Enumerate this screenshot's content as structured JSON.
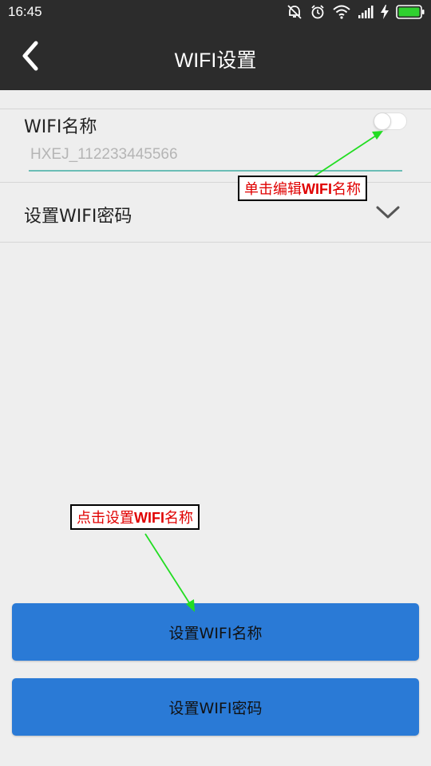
{
  "status_bar": {
    "time": "16:45",
    "icons": [
      "alarm-off-icon",
      "alarm-clock-icon",
      "wifi-signal-icon",
      "cell-signal-icon",
      "charging-bolt-icon",
      "battery-icon"
    ],
    "battery_color": "#2fd12f"
  },
  "header": {
    "title": "WIFI设置",
    "back_icon": "chevron-left-icon"
  },
  "wifi_name_row": {
    "label": "WIFI名称",
    "input_placeholder": "HXEJ_112233445566",
    "input_value": "",
    "toggle_on": false
  },
  "wifi_password_row": {
    "label": "设置WIFI密码",
    "expand_icon": "chevron-down-icon"
  },
  "buttons": {
    "set_name": "设置WIFI名称",
    "set_password": "设置WIFI密码"
  },
  "annotations": {
    "edit_name": {
      "prefix": "单击编辑",
      "bold": "WIFI",
      "suffix": "名称"
    },
    "set_name": {
      "prefix": "点击设置",
      "bold": "WIFI",
      "suffix": "名称"
    }
  },
  "colors": {
    "title_bar": "#2c2c2c",
    "background": "#eeeeee",
    "button": "#2a7ad6",
    "input_underline": "#6bbdb6",
    "annotation_text": "#e00000",
    "annotation_arrow": "#22dd22"
  }
}
